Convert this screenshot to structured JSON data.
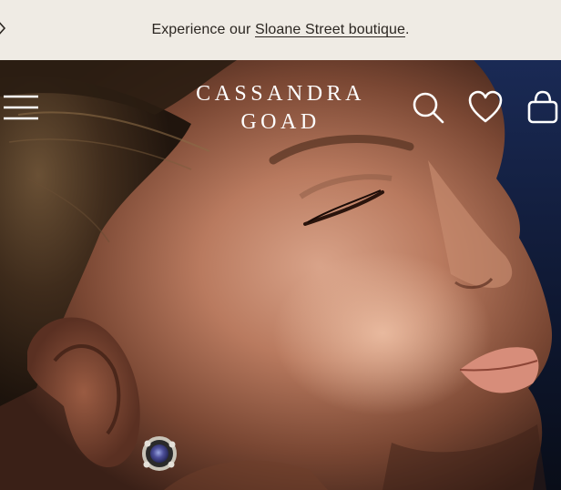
{
  "announcement": {
    "prefix": "Experience our ",
    "link_text": "Sloane Street boutique",
    "suffix": ".",
    "background": "#efebe4",
    "text_color": "#2b2621"
  },
  "header": {
    "logo_line1": "CASSANDRA",
    "logo_line2": "GOAD",
    "icons": [
      "menu-icon",
      "search-icon",
      "heart-icon",
      "shopping-bag-icon"
    ]
  },
  "hero": {
    "subject": "woman with closed eyes wearing a sapphire stud earring"
  }
}
